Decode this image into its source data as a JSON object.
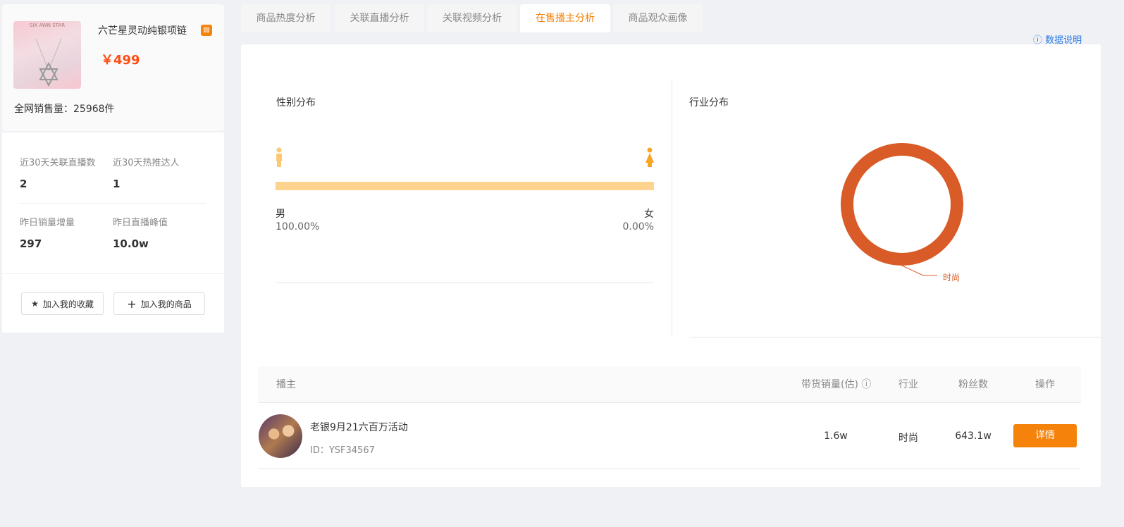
{
  "product": {
    "title": "六芒星灵动纯银项链",
    "price": "￥499",
    "sales": "全网销售量：25968件",
    "image_text": "SIX AWN STAR",
    "shop_icon": "shop-icon"
  },
  "stats": [
    {
      "label": "近30天关联直播数",
      "value": "2"
    },
    {
      "label": "近30天热推达人",
      "value": "1"
    },
    {
      "label": "昨日销量增量",
      "value": "297"
    },
    {
      "label": "昨日直播峰值",
      "value": "10.0w"
    }
  ],
  "actions": {
    "favorite": "加入我的收藏",
    "add_product": "加入我的商品"
  },
  "tabs": [
    "商品热度分析",
    "关联直播分析",
    "关联视频分析",
    "在售播主分析",
    "商品观众画像"
  ],
  "active_tab": 3,
  "data_note": "数据说明",
  "gender": {
    "title": "性别分布",
    "male_label": "男",
    "male_pct": "100.00%",
    "female_label": "女",
    "female_pct": "0.00%",
    "male_fraction": 1.0
  },
  "industry": {
    "title": "行业分布",
    "slices": [
      {
        "name": "时尚",
        "value": 100,
        "color": "#d95b27"
      }
    ]
  },
  "table": {
    "headers": [
      "播主",
      "带货销量(估)",
      "行业",
      "粉丝数",
      "操作"
    ],
    "rows": [
      {
        "name": "老银9月21六百万活动",
        "id": "ID：YSF34567",
        "sales": "1.6w",
        "industry": "时尚",
        "fans": "643.1w",
        "action": "详情"
      }
    ]
  },
  "colors": {
    "accent": "#f5820a",
    "price": "#ff4d12",
    "donut": "#d95b27",
    "bar": "#fdd38e"
  }
}
